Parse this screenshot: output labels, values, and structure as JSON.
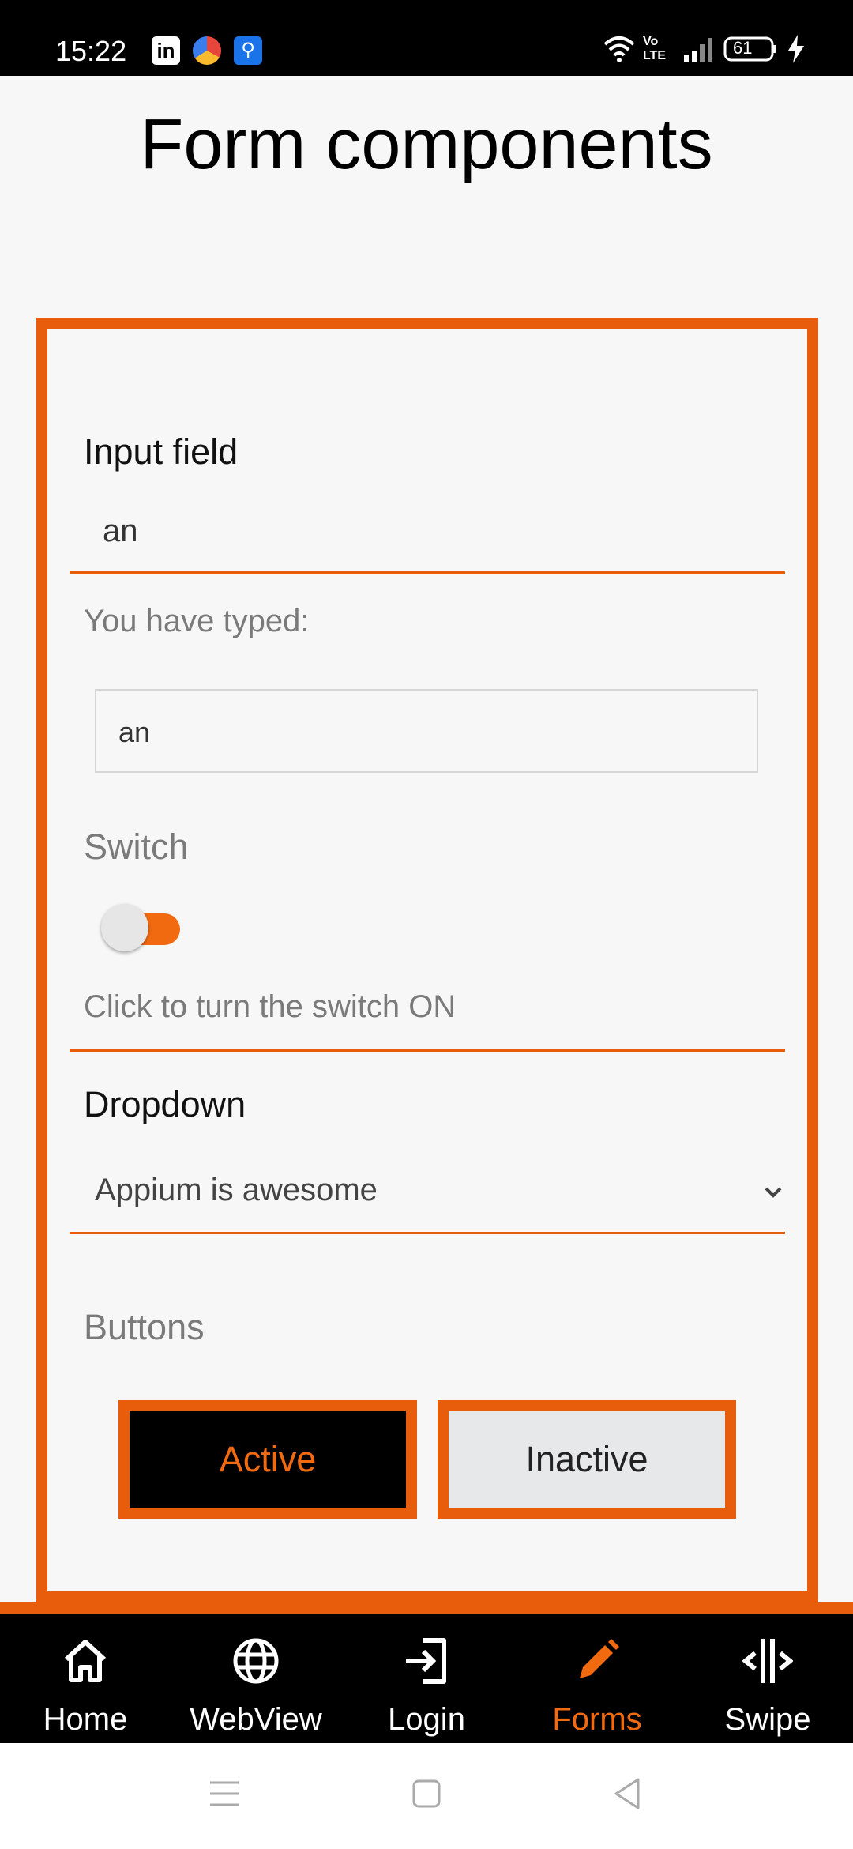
{
  "status_bar": {
    "time": "15:22",
    "app_icons": [
      "linkedin-icon",
      "browser-icon",
      "usb-icon"
    ],
    "battery": "61",
    "network": "Vo LTE"
  },
  "page": {
    "title": "Form components"
  },
  "form": {
    "input_label": "Input field",
    "input_value": "an",
    "typed_label": "You have typed:",
    "typed_value": "an",
    "switch_label": "Switch",
    "switch_state": "off",
    "switch_hint": "Click to turn the switch ON",
    "dropdown_label": "Dropdown",
    "dropdown_value": "Appium is awesome",
    "buttons_label": "Buttons",
    "active_button": "Active",
    "inactive_button": "Inactive"
  },
  "bottom_nav": {
    "items": [
      {
        "label": "Home",
        "icon": "home-icon"
      },
      {
        "label": "WebView",
        "icon": "globe-icon"
      },
      {
        "label": "Login",
        "icon": "login-icon"
      },
      {
        "label": "Forms",
        "icon": "pencil-icon",
        "active": true
      },
      {
        "label": "Swipe",
        "icon": "swipe-icon"
      }
    ]
  },
  "colors": {
    "accent": "#e85d0c",
    "accent_text": "#f26a10",
    "background": "#f7f7f7"
  }
}
